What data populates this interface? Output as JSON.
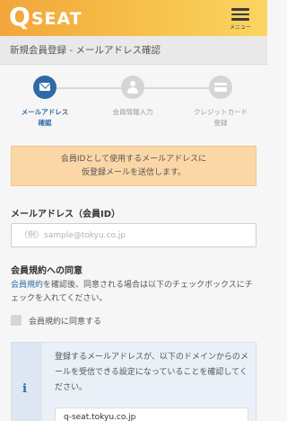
{
  "header": {
    "logo_q": "Q",
    "logo_rest": "SEAT",
    "menu_label": "メニュー"
  },
  "page_title": "新規会員登録 - メールアドレス確認",
  "steps": [
    {
      "label_line1": "メールアドレス",
      "label_line2": "確認",
      "icon": "envelope-icon",
      "active": true
    },
    {
      "label_line1": "会員情報入力",
      "label_line2": "",
      "icon": "person-icon",
      "active": false
    },
    {
      "label_line1": "クレジットカード",
      "label_line2": "登録",
      "icon": "credit-card-icon",
      "active": false
    }
  ],
  "notice": {
    "line1": "会員IDとして使用するメールアドレスに",
    "line2": "仮登録メールを送信します。"
  },
  "email": {
    "label": "メールアドレス（会員ID）",
    "placeholder": "（例）sample@tokyu.co.jp",
    "value": ""
  },
  "terms": {
    "title": "会員規約への同意",
    "link": "会員規約",
    "text_rest": "を確認後、同意される場合は以下のチェックボックスにチェックを入れてください。",
    "checkbox_label": "会員規約に同意する",
    "checked": false
  },
  "info": {
    "icon": "info-icon",
    "text": "登録するメールアドレスが、以下のドメインからのメールを受信できる設定になっていることを確認してください。",
    "domain": "q-seat.tokyu.co.jp"
  },
  "colors": {
    "header_start": "#f2a53a",
    "header_end": "#fad463",
    "accent_blue": "#2e6aa8",
    "notice_bg": "#fbd7a8"
  }
}
